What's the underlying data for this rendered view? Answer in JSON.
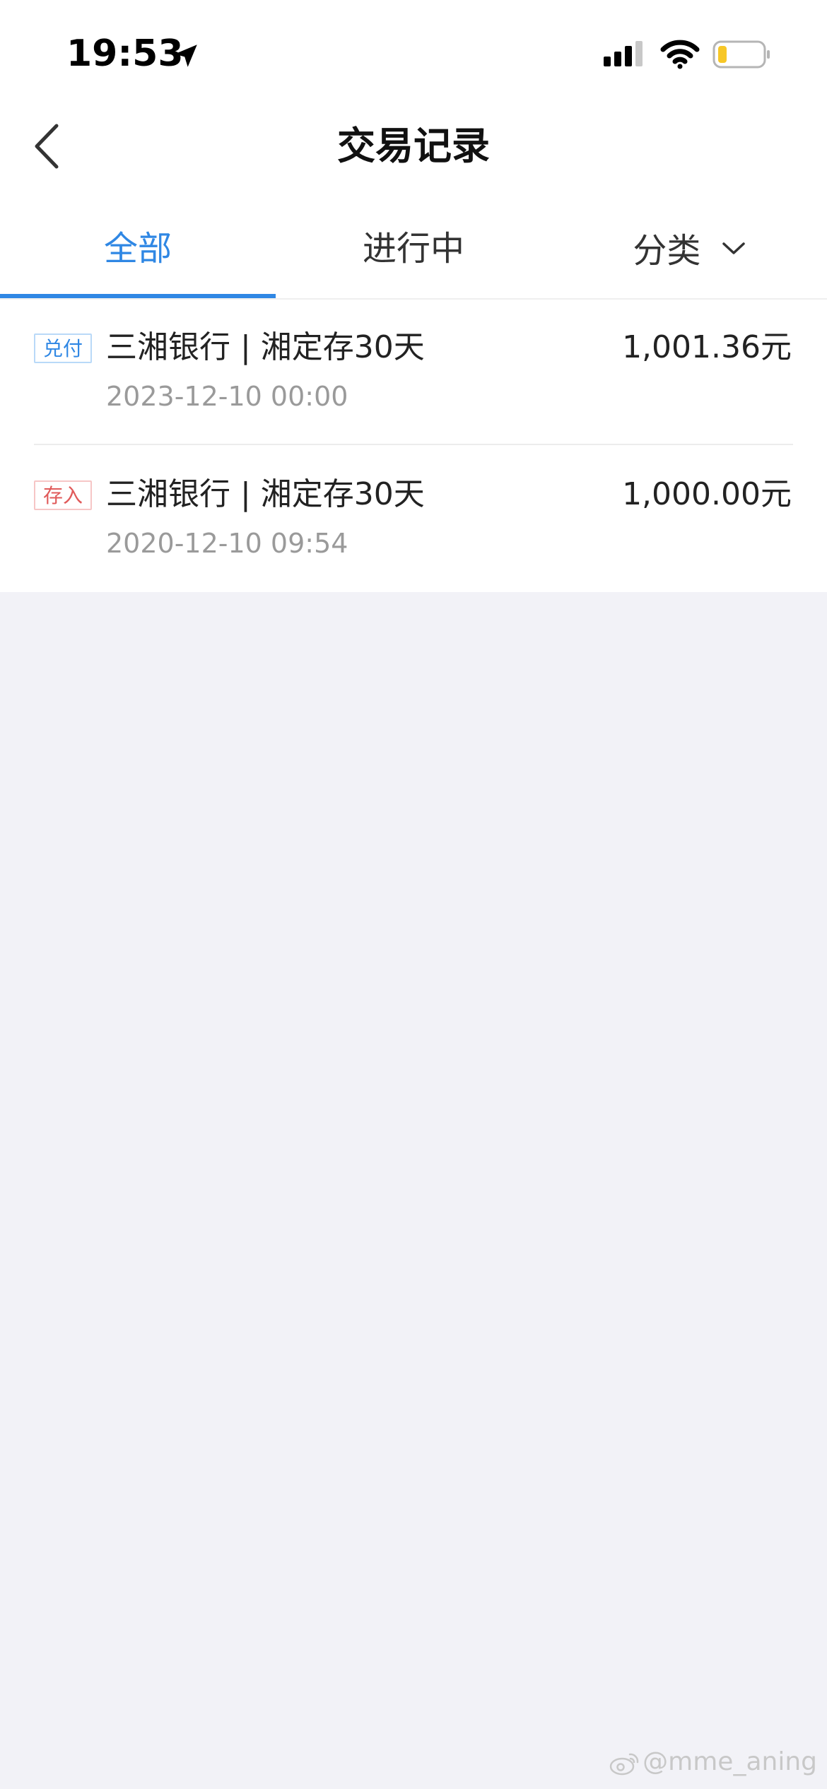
{
  "status_bar": {
    "time": "19:53",
    "icons": [
      "location-arrow-icon",
      "cellular-signal-icon",
      "wifi-icon",
      "battery-icon"
    ]
  },
  "nav": {
    "back_icon": "chevron-left-icon",
    "title": "交易记录"
  },
  "tabs": [
    {
      "label": "全部",
      "active": true
    },
    {
      "label": "进行中",
      "active": false
    },
    {
      "label": "分类",
      "active": false,
      "icon": "chevron-down-icon"
    }
  ],
  "transactions": [
    {
      "badge": "兑付",
      "badge_color": "#2f87e4",
      "name": "三湘银行 | 湘定存30天",
      "amount": "1,001.36元",
      "time": "2023-12-10 00:00"
    },
    {
      "badge": "存入",
      "badge_color": "#e05a5a",
      "name": "三湘银行 | 湘定存30天",
      "amount": "1,000.00元",
      "time": "2020-12-10 09:54"
    }
  ],
  "watermark": {
    "icon": "weibo-icon",
    "text": "@mme_aning"
  },
  "colors": {
    "accent": "#2f87e4",
    "deposit": "#e05a5a",
    "page_background": "#f2f2f7",
    "battery_level": "#f7c727"
  }
}
